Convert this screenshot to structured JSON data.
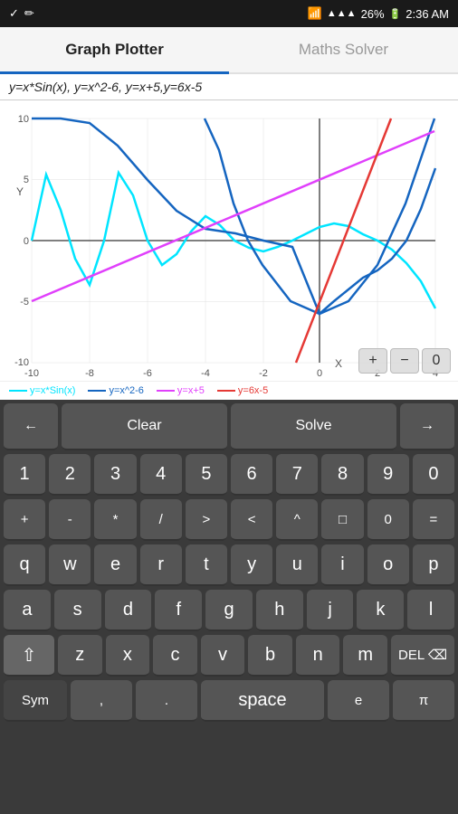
{
  "statusBar": {
    "time": "2:36 AM",
    "battery": "26%",
    "icons": [
      "check-icon",
      "edit-icon",
      "wifi-icon",
      "signal-icon",
      "battery-icon"
    ]
  },
  "tabs": [
    {
      "id": "graph",
      "label": "Graph Plotter",
      "active": true
    },
    {
      "id": "maths",
      "label": "Maths Solver",
      "active": false
    }
  ],
  "graph": {
    "equation": "y=x*Sin(x),  y=x^2-6,  y=x+5,y=6x-5",
    "legend": [
      {
        "label": "y=x*Sin(x)",
        "color": "#00e5ff"
      },
      {
        "label": "y=x^2-6",
        "color": "#1565c0"
      },
      {
        "label": "y=x+5",
        "color": "#e040fb"
      },
      {
        "label": "y=6x-5",
        "color": "#e53935"
      }
    ],
    "xLabel": "X",
    "yLabel": "Y",
    "zoom": {
      "in": "+",
      "out": "−",
      "reset": "0"
    }
  },
  "keyboard": {
    "actionRow": [
      {
        "id": "back-arrow",
        "label": "←"
      },
      {
        "id": "clear",
        "label": "Clear"
      },
      {
        "id": "solve",
        "label": "Solve"
      },
      {
        "id": "forward-arrow",
        "label": "→"
      }
    ],
    "numRow": [
      "1",
      "2",
      "3",
      "4",
      "5",
      "6",
      "7",
      "8",
      "9",
      "0"
    ],
    "symbolRow": [
      "+",
      "-",
      "*",
      "/",
      ">",
      "<",
      "^",
      "□",
      "0",
      "="
    ],
    "row1": [
      "q",
      "w",
      "e",
      "r",
      "t",
      "y",
      "u",
      "i",
      "o",
      "p"
    ],
    "row2": [
      "a",
      "s",
      "d",
      "f",
      "g",
      "h",
      "j",
      "k",
      "l"
    ],
    "row3Special": "⇧",
    "row3": [
      "z",
      "x",
      "c",
      "v",
      "b",
      "n",
      "m"
    ],
    "row3Del": "DEL ⌫",
    "bottomLeft": "Sym",
    "bottomRow": [
      ",",
      ".",
      "space",
      "e",
      "π"
    ]
  }
}
